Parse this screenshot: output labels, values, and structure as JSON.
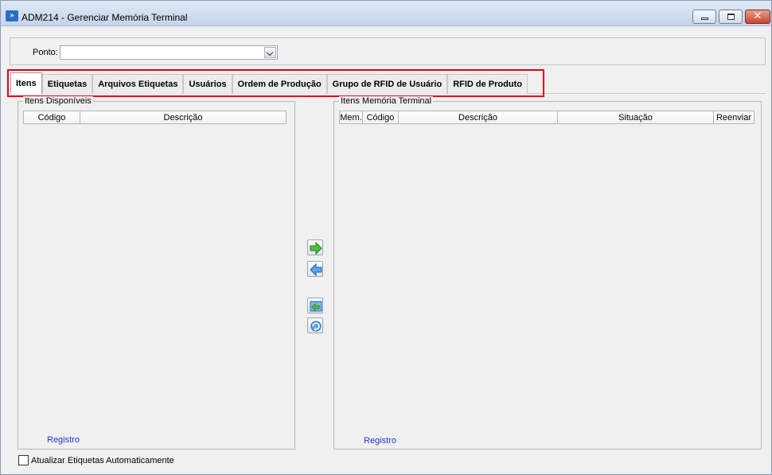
{
  "window": {
    "title": "ADM214 - Gerenciar Memória Terminal",
    "close_glyph": "✕"
  },
  "ponto": {
    "label": "Ponto:",
    "value": ""
  },
  "tabs": [
    {
      "label": "Itens",
      "active": true
    },
    {
      "label": "Etiquetas"
    },
    {
      "label": "Arquivos Etiquetas"
    },
    {
      "label": "Usuários"
    },
    {
      "label": "Ordem de Produção"
    },
    {
      "label": "Grupo de RFID de Usuário"
    },
    {
      "label": "RFID de Produto"
    }
  ],
  "left_group": {
    "title": "Itens Disponíveis",
    "columns": [
      "Código",
      "Descrição"
    ],
    "footer": "Registro"
  },
  "right_group": {
    "title": "Itens Memória Terminal",
    "columns": [
      "Mem.",
      "Código",
      "Descrição",
      "Situação",
      "Reenviar"
    ],
    "footer": "Registro"
  },
  "transfer_buttons": [
    {
      "icon": "arrow-right-green-icon"
    },
    {
      "icon": "arrow-left-blue-icon"
    },
    {
      "icon": "transfer-all-icon"
    },
    {
      "icon": "refresh-icon"
    }
  ],
  "auto_update": {
    "label": "Atualizar Etiquetas Automaticamente",
    "checked": false
  },
  "colors": {
    "highlight": "#e4001b",
    "link": "#1c3cc8"
  }
}
